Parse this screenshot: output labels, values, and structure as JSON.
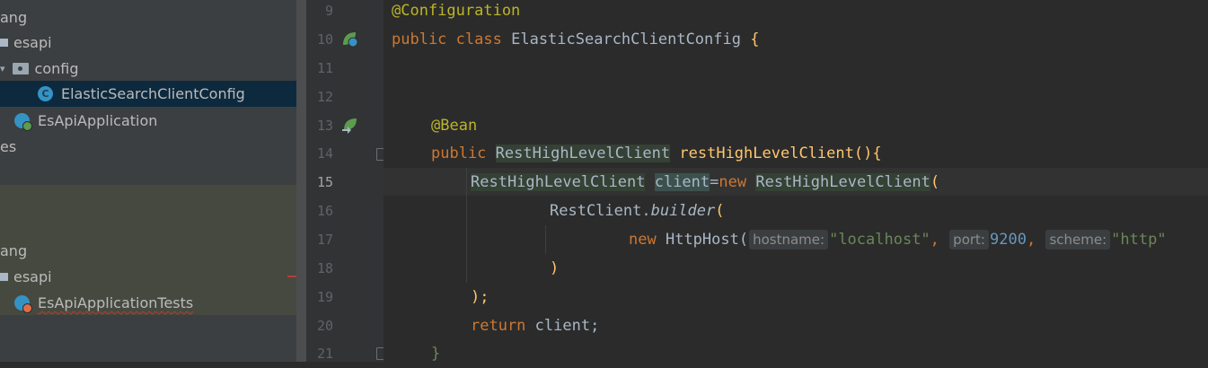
{
  "tree": {
    "items": [
      {
        "label": "ang"
      },
      {
        "label": "esapi"
      },
      {
        "label": "config"
      },
      {
        "label": "ElasticSearchClientConfig",
        "icon_letter": "C"
      },
      {
        "label": "EsApiApplication"
      },
      {
        "label": "es"
      },
      {
        "label": "ang"
      },
      {
        "label": "esapi"
      },
      {
        "label": "EsApiApplicationTests"
      }
    ]
  },
  "gutter": {
    "line_numbers": [
      "9",
      "10",
      "11",
      "12",
      "13",
      "14",
      "15",
      "16",
      "17",
      "18",
      "19",
      "20",
      "21"
    ],
    "current_line": "15"
  },
  "code": {
    "l9_annotation": "@Configuration",
    "l10_public": "public",
    "l10_class": "class",
    "l10_name": "ElasticSearchClientConfig",
    "l10_brace": "{",
    "l13_annotation": "@Bean",
    "l14_public": "public",
    "l14_type": "RestHighLevelClient",
    "l14_method": "restHighLevelClient",
    "l14_parens": "(){",
    "l15_type": "RestHighLevelClient",
    "l15_var": "client",
    "l15_eq": "=",
    "l15_new": "new",
    "l15_ctor": "RestHighLevelClient",
    "l15_paren": "(",
    "l16_restclient": "RestClient.",
    "l16_builder": "builder",
    "l16_paren": "(",
    "l17_new": "new",
    "l17_httphost": "HttpHost(",
    "l17_hint_hostname": "hostname:",
    "l17_str_localhost": "\"localhost\"",
    "l17_comma1": ",",
    "l17_hint_port": "port:",
    "l17_port": "9200",
    "l17_comma2": ",",
    "l17_hint_scheme": "scheme:",
    "l17_str_http": "\"http\"",
    "l18_paren": ")",
    "l19_close": ");",
    "l20_return": "return",
    "l20_client": "client;",
    "l21_brace": "}"
  },
  "colors": {
    "keyword": "#cc7832",
    "annotation": "#bbb529",
    "method": "#ffc66d",
    "string": "#6a8759",
    "number": "#6897bb",
    "text": "#a9b7c6"
  }
}
